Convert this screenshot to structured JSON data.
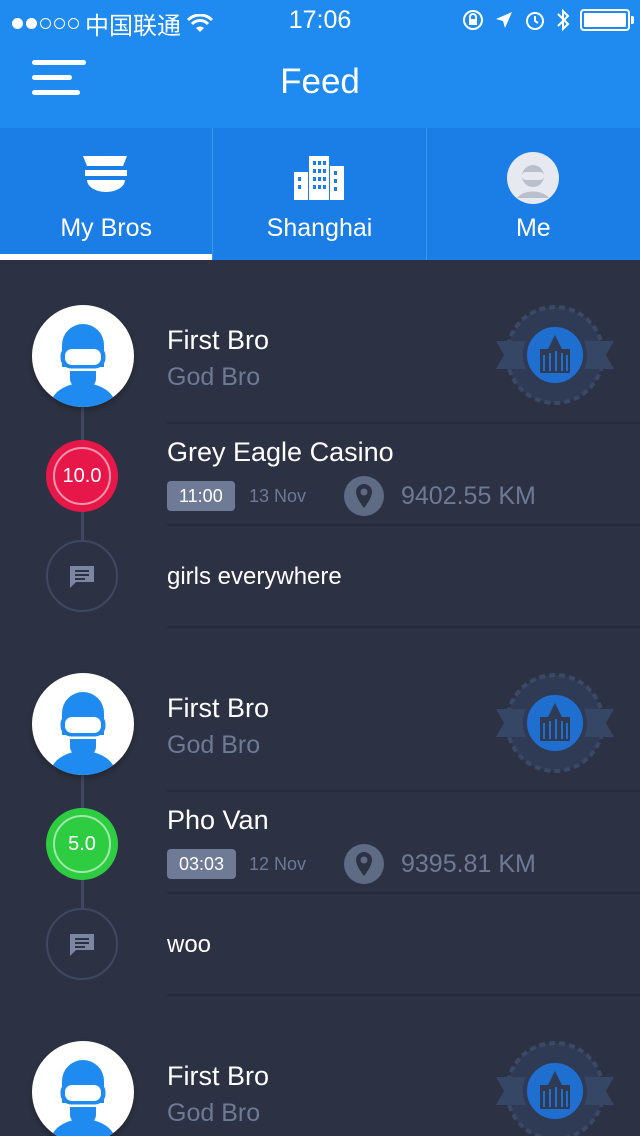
{
  "status_bar": {
    "carrier": "中国联通",
    "time": "17:06",
    "signal_dots_filled": 2,
    "signal_dots_total": 5
  },
  "nav": {
    "title": "Feed",
    "menu_icon": "hamburger-menu-icon"
  },
  "tabs": [
    {
      "label": "My Bros",
      "icon": "bro-hat-icon",
      "active": true
    },
    {
      "label": "Shanghai",
      "icon": "city-buildings-icon",
      "active": false
    },
    {
      "label": "Me",
      "icon": "profile-avatar-icon",
      "active": false
    }
  ],
  "feed": [
    {
      "user_name": "First Bro",
      "user_title": "God Bro",
      "place": "Grey Eagle Casino",
      "score": "10.0",
      "score_color": "#e8174a",
      "time": "11:00",
      "date": "13 Nov",
      "distance": "9402.55 KM",
      "comment": "girls everywhere"
    },
    {
      "user_name": "First Bro",
      "user_title": "God Bro",
      "place": "Pho Van",
      "score": "5.0",
      "score_color": "#2ecc40",
      "time": "03:03",
      "date": "12 Nov",
      "distance": "9395.81 KM",
      "comment": "woo"
    },
    {
      "user_name": "First Bro",
      "user_title": "God Bro"
    }
  ],
  "colors": {
    "brand_blue": "#1f8bf0",
    "background": "#2c3243",
    "muted_text": "#6d7995"
  }
}
